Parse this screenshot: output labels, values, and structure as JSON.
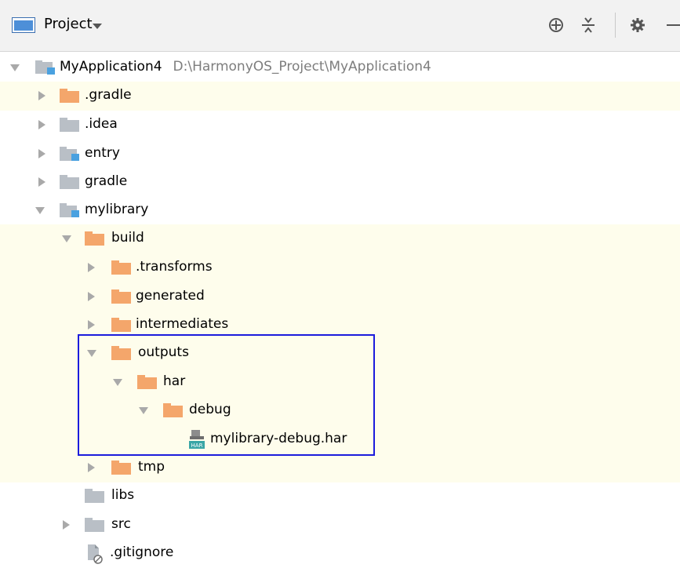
{
  "toolbar": {
    "title": "Project",
    "icons": [
      "crosshair-icon",
      "collapse-all-icon",
      "gear-icon",
      "minimize-icon"
    ]
  },
  "tree": {
    "root": {
      "name": "MyApplication4",
      "path": "D:\\HarmonyOS_Project\\MyApplication4"
    },
    "items": {
      "gradle_dot": ".gradle",
      "idea": ".idea",
      "entry": "entry",
      "gradle": "gradle",
      "mylibrary": "mylibrary",
      "build": "build",
      "transforms": ".transforms",
      "generated": "generated",
      "intermediates": "intermediates",
      "outputs": "outputs",
      "har": "har",
      "debug": "debug",
      "har_file": "mylibrary-debug.har",
      "tmp": "tmp",
      "libs": "libs",
      "src": "src",
      "gitignore": ".gitignore"
    }
  },
  "colors": {
    "toolbar_bg": "#f2f2f2",
    "highlight_bg": "#fefdec",
    "orange_folder": "#f4a66b",
    "gray_folder": "#b9bfc6",
    "module_badge": "#4aa1e0",
    "selection_border": "#1c1cdc"
  }
}
